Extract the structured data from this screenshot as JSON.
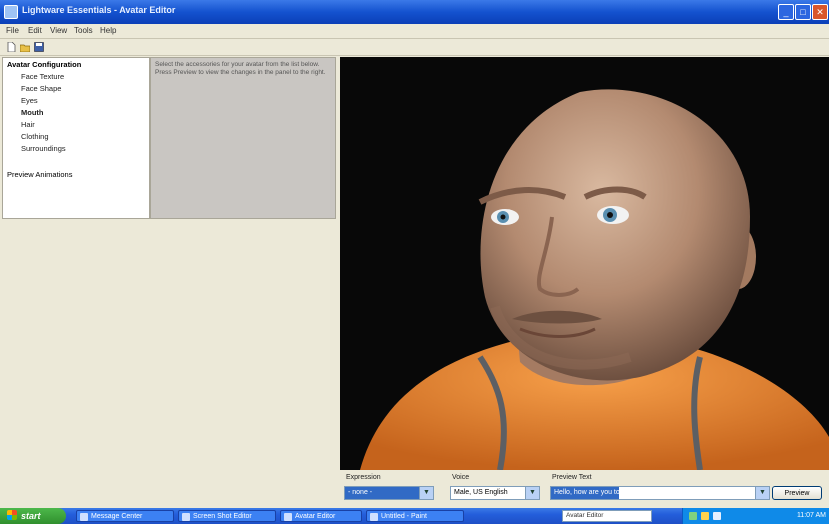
{
  "window": {
    "title": "Lightware Essentials - Avatar Editor",
    "buttons": [
      "_",
      "□",
      "✕"
    ]
  },
  "menu": [
    "File",
    "Edit",
    "View",
    "Tools",
    "Help"
  ],
  "toolbar": {
    "icons": [
      "new-icon",
      "open-icon",
      "save-icon"
    ]
  },
  "tree": {
    "root": "Avatar Configuration",
    "items": [
      "Face Texture",
      "Face Shape",
      "Eyes",
      "Mouth",
      "Hair",
      "Clothing",
      "Surroundings"
    ],
    "footer": "Preview Animations"
  },
  "description": "Select the accessories for your avatar from the list below. Press Preview to view the changes in the panel to the right.",
  "controls": {
    "expression_label": "Expression",
    "expression_value": "- none -",
    "voice_label": "Voice",
    "voice_value": "Male, US English",
    "preview_text_label": "Preview Text",
    "preview_text_value": "Hello, how are you today?",
    "preview_button": "Preview"
  },
  "taskbar": {
    "start": "start",
    "tasks": [
      "Message Center",
      "Screen Shot Editor",
      "Avatar Editor",
      "Untitled - Paint"
    ],
    "address": "Avatar Editor",
    "clock": "11:07 AM"
  },
  "colors": {
    "titlebar": "#1452cf",
    "viewport_bg": "#080808",
    "shirt": "#f08a2c",
    "skin": "#b88d72"
  }
}
